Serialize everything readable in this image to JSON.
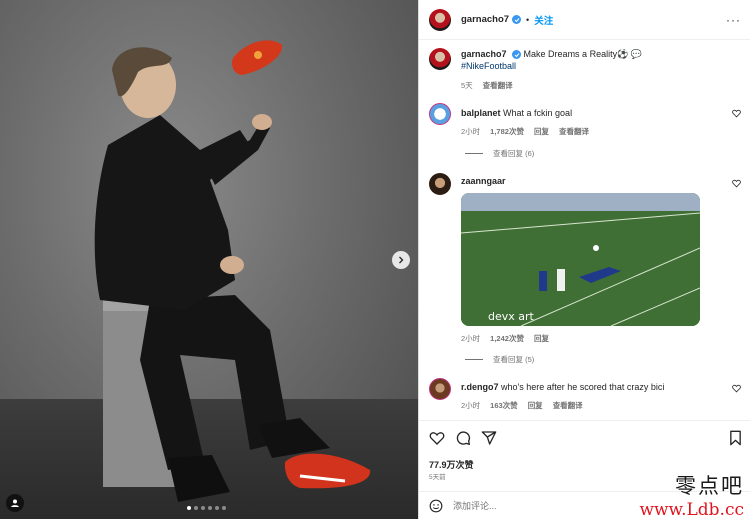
{
  "post": {
    "username": "garnacho7",
    "follow_label": "关注",
    "more_label": "···",
    "caption": {
      "username": "garnacho7",
      "text": "Make Dreams a Reality⚽",
      "hashtag": "#NikeFootball",
      "age": "5天",
      "see_translation": "查看翻译"
    },
    "likes": "77.9万次赞",
    "posted": "5天前",
    "add_comment_placeholder": "添加评论..."
  },
  "comments": [
    {
      "username": "balplanet",
      "text": "What a fckin goal",
      "age": "2小时",
      "likes": "1,782次赞",
      "reply": "回复",
      "see_translation": "查看翻译",
      "view_replies": "查看回复 (6)"
    },
    {
      "username": "zaanngaar",
      "text": "",
      "media_watermark": "devx art",
      "age": "2小时",
      "likes": "1,242次赞",
      "reply": "回复",
      "view_replies": "查看回复 (5)"
    },
    {
      "username": "r.dengo7",
      "text": "who's here after he scored that crazy bici",
      "age": "2小时",
      "likes": "163次赞",
      "reply": "回复",
      "see_translation": "查看翻译"
    }
  ],
  "watermark": {
    "cn": "零点吧",
    "url": "www.Ldb.cc"
  },
  "carousel": {
    "count": 6,
    "active_index": 0
  },
  "icons": [
    "heart-icon",
    "comment-icon",
    "share-icon",
    "bookmark-icon",
    "more-icon",
    "user-tag-icon",
    "next-arrow-icon",
    "emoji-icon",
    "verified-icon"
  ],
  "colors": {
    "accent": "#0095f6",
    "hashtag": "#00376b",
    "verified": "#3897f0",
    "muted": "#737373",
    "watermark_red": "#e0141e"
  }
}
